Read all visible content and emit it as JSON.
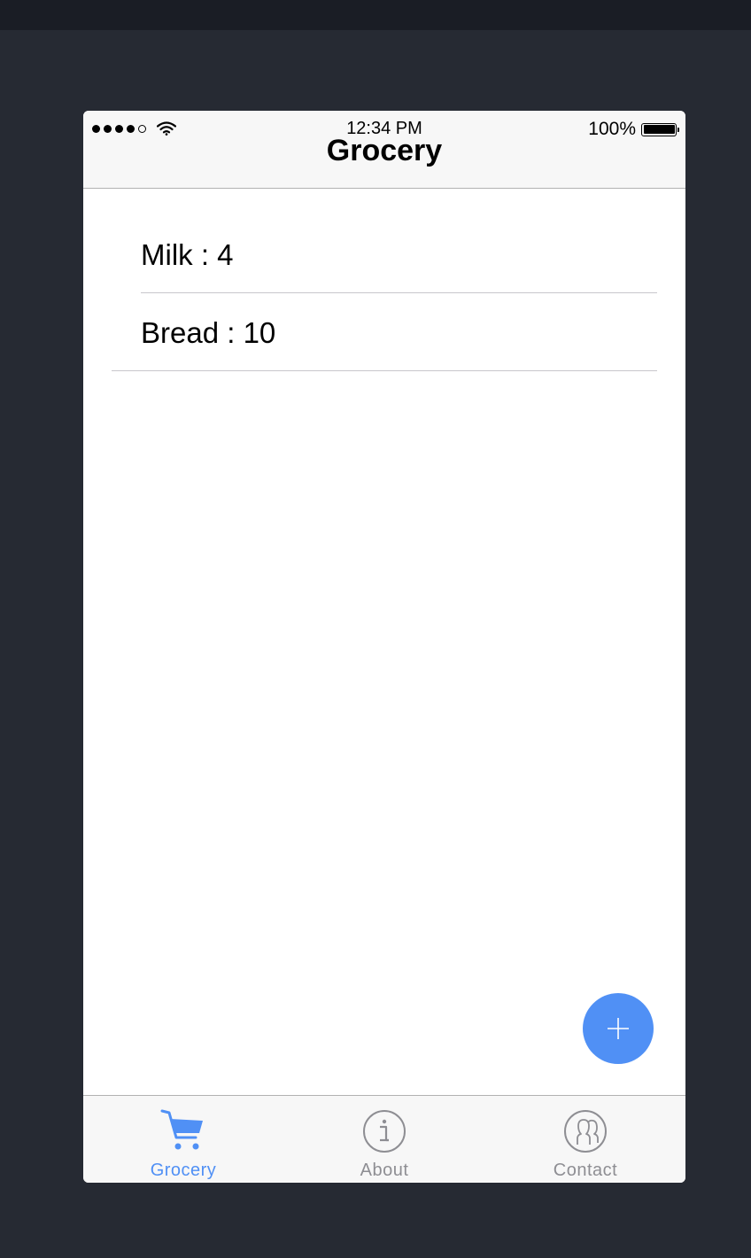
{
  "status_bar": {
    "signal_bars": 4,
    "signal_total": 5,
    "time": "12:34 PM",
    "battery_percent": "100%"
  },
  "navbar": {
    "title": "Grocery"
  },
  "grocery_list": {
    "items": [
      {
        "label": "Milk : 4"
      },
      {
        "label": "Bread : 10"
      }
    ]
  },
  "fab": {
    "icon": "plus-icon"
  },
  "tabbar": {
    "tabs": [
      {
        "label": "Grocery",
        "icon": "cart-icon",
        "active": true
      },
      {
        "label": "About",
        "icon": "info-icon",
        "active": false
      },
      {
        "label": "Contact",
        "icon": "contacts-icon",
        "active": false
      }
    ]
  },
  "colors": {
    "accent": "#5090f5",
    "inactive": "#8e8e93",
    "background": "#262a33"
  }
}
